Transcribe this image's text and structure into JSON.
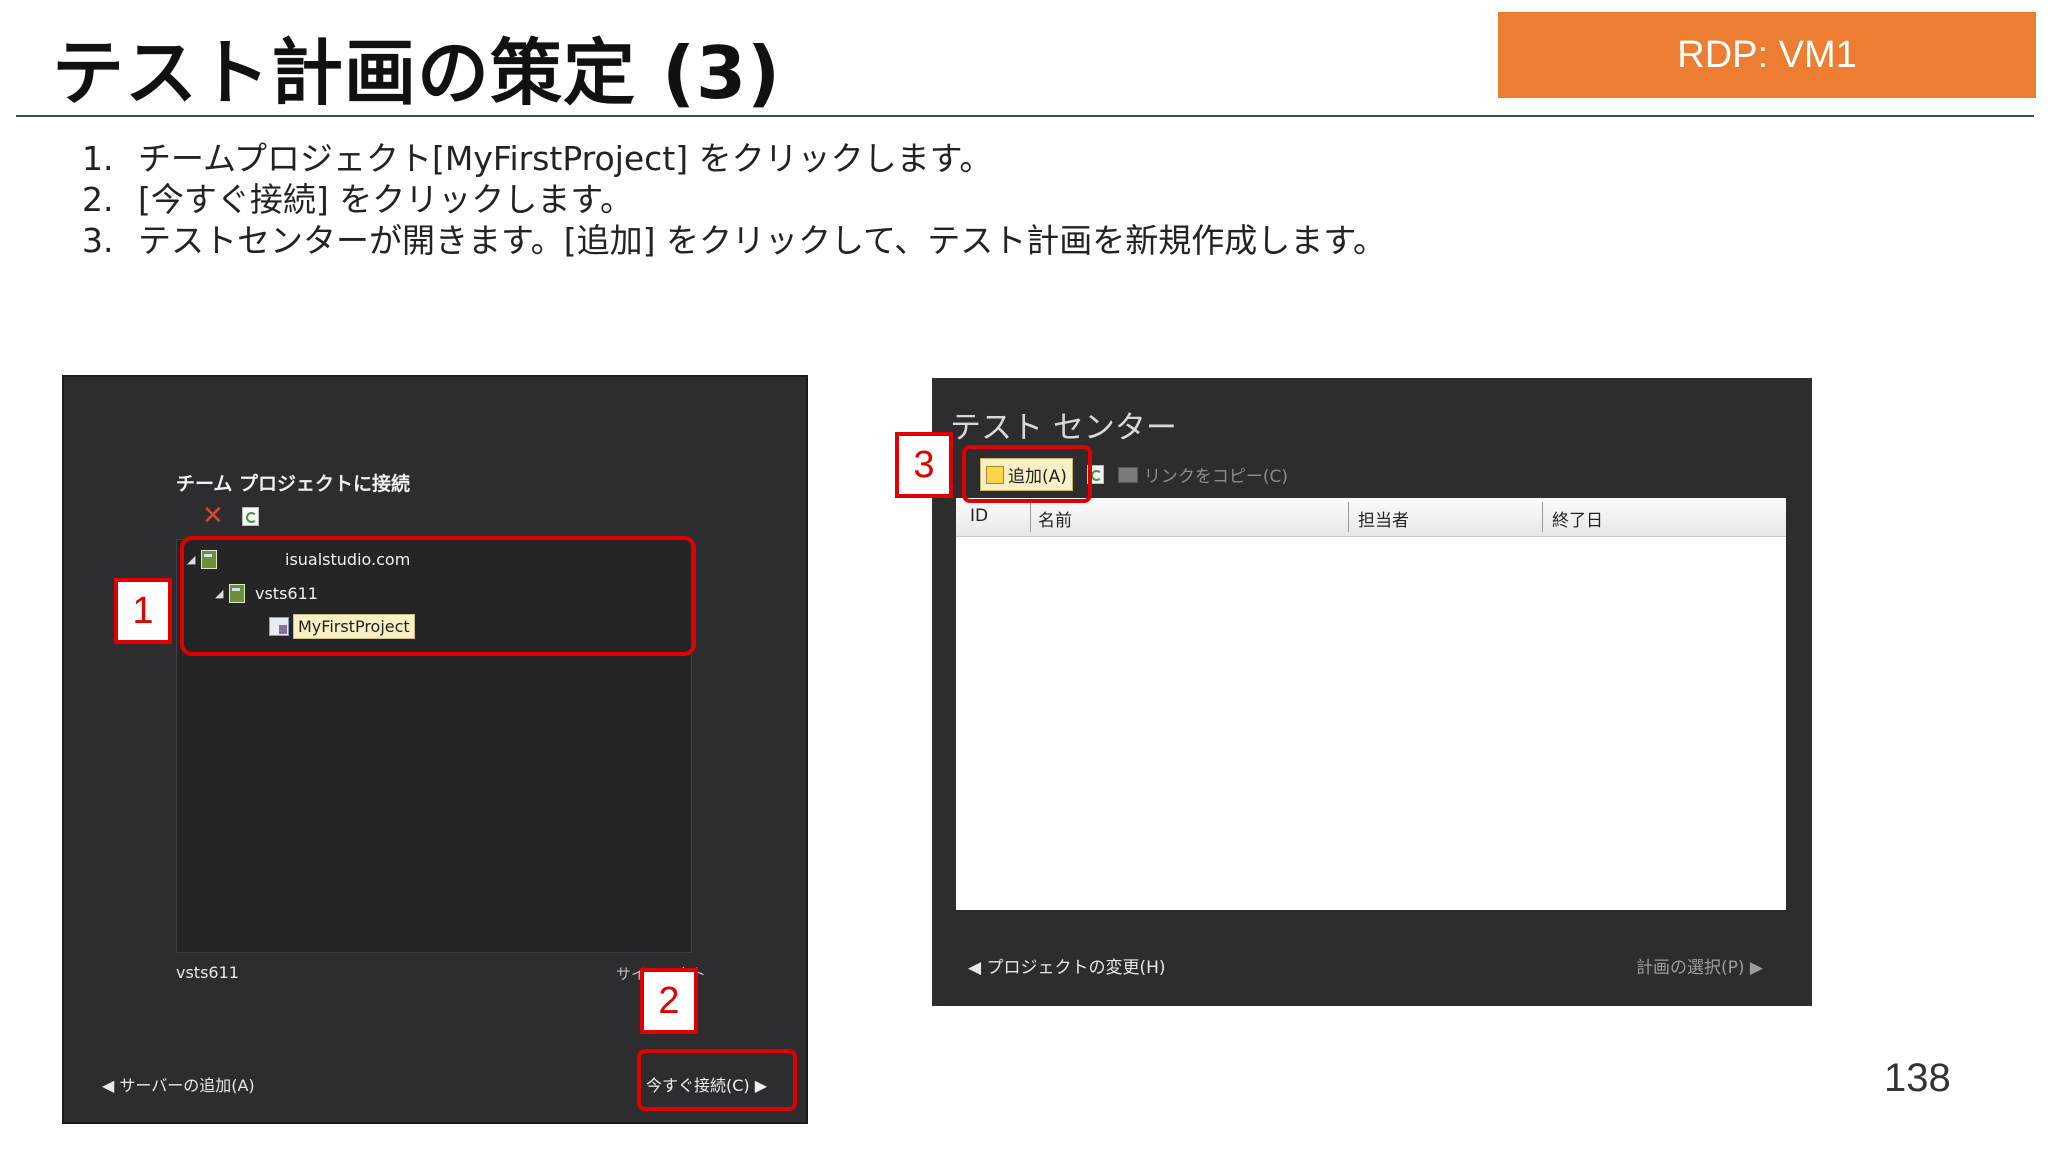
{
  "title": "テスト計画の策定 (3)",
  "badge": "RDP: VM1",
  "steps": [
    {
      "num": "1.",
      "text": "チームプロジェクト[MyFirstProject] をクリックします。"
    },
    {
      "num": "2.",
      "text": "[今すぐ接続] をクリックします。"
    },
    {
      "num": "3.",
      "text": "テストセンターが開きます。[追加] をクリックして、テスト計画を新規作成します。"
    }
  ],
  "page_number": "138",
  "left_panel": {
    "heading": "チーム プロジェクトに接続",
    "server": "isualstudio.com",
    "collection": "vsts611",
    "project": "MyFirstProject",
    "footer_account": "vsts611",
    "footer_signout": "サインアウト",
    "back_label": "◀ サーバーの追加(A)",
    "connect_label": "今すぐ接続(C) ▶"
  },
  "right_panel": {
    "heading": "テスト センター",
    "add_label": "追加(A)",
    "copy_link_label": "リンクをコピー(C)",
    "columns": [
      "ID",
      "名前",
      "担当者",
      "終了日"
    ],
    "back_label": "◀ プロジェクトの変更(H)",
    "next_label": "計画の選択(P) ▶"
  },
  "callouts": [
    "1",
    "2",
    "3"
  ]
}
